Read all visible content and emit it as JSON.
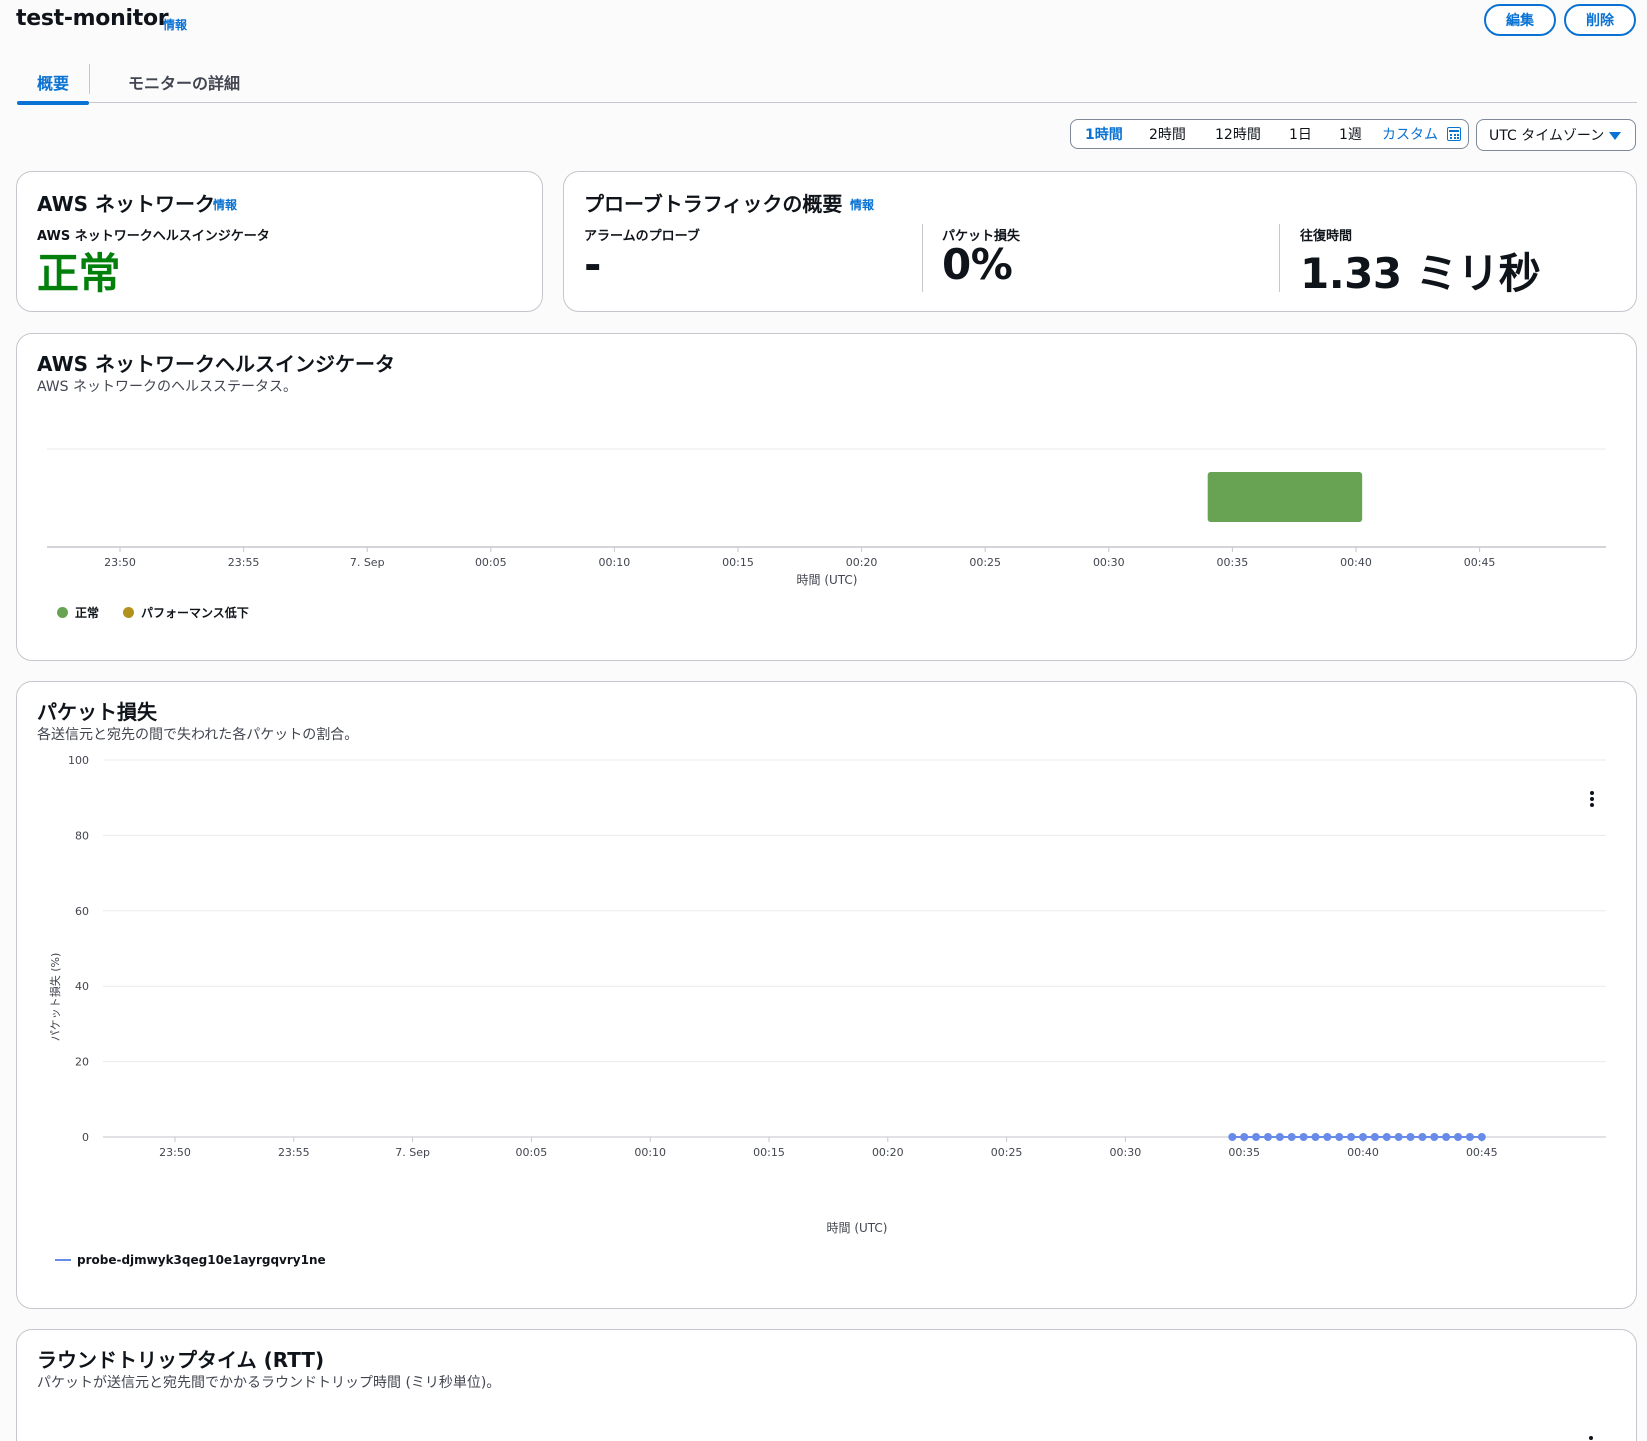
{
  "header": {
    "title": "test-monitor",
    "info_label": "情報",
    "edit_label": "編集",
    "delete_label": "削除"
  },
  "tabs": [
    {
      "label": "概要",
      "active": true
    },
    {
      "label": "モニターの詳細",
      "active": false
    }
  ],
  "time_range": {
    "options": [
      "1時間",
      "2時間",
      "12時間",
      "1日",
      "1週"
    ],
    "selected": "1時間",
    "custom_label": "カスタム",
    "timezone_label": "UTC タイムゾーン"
  },
  "aws_network_card": {
    "title": "AWS ネットワーク",
    "info_label": "情報",
    "indicator_label": "AWS ネットワークヘルスインジケータ",
    "indicator_value": "正常",
    "status_color": "#037f0c"
  },
  "probe_traffic_card": {
    "title": "プローブトラフィックの概要",
    "info_label": "情報",
    "metrics": [
      {
        "label": "アラームのプローブ",
        "value": "-"
      },
      {
        "label": "パケット損失",
        "value": "0%"
      },
      {
        "label": "往復時間",
        "value": "1.33 ミリ秒"
      }
    ]
  },
  "health_panel": {
    "title": "AWS ネットワークヘルスインジケータ",
    "subtitle": "AWS ネットワークのヘルスステータス。",
    "x_ticks": [
      "23:50",
      "23:55",
      "7. Sep",
      "00:05",
      "00:10",
      "00:15",
      "00:20",
      "00:25",
      "00:30",
      "00:35",
      "00:40",
      "00:45"
    ],
    "x_axis_label": "時間 (UTC)",
    "legend": [
      {
        "label": "正常",
        "color": "#67a353"
      },
      {
        "label": "パフォーマンス低下",
        "color": "#b2911c"
      }
    ]
  },
  "packet_loss_panel": {
    "title": "パケット損失",
    "subtitle": "各送信元と宛先の間で失われた各パケットの割合。",
    "y_axis_label": "パケット損失 (%)",
    "x_axis_label": "時間 (UTC)",
    "menu_icon": "more-vertical-icon",
    "legend_label": "probe-djmwyk3qeg10e1ayrgqvry1ne",
    "series_color": "#688ae8"
  },
  "rtt_panel": {
    "title": "ラウンドトリップタイム (RTT)",
    "subtitle": "パケットが送信元と宛先間でかかるラウンドトリップ時間 (ミリ秒単位)。"
  },
  "chart_data": [
    {
      "type": "bar",
      "title": "AWS ネットワークヘルスインジケータ",
      "xlabel": "時間 (UTC)",
      "x_ticks": [
        "23:50",
        "23:55",
        "7. Sep",
        "00:05",
        "00:10",
        "00:15",
        "00:20",
        "00:25",
        "00:30",
        "00:35",
        "00:40",
        "00:45"
      ],
      "series": [
        {
          "name": "正常",
          "color": "#67a353",
          "intervals": [
            {
              "start": "00:34",
              "end": "00:40:15",
              "status": "正常"
            }
          ]
        },
        {
          "name": "パフォーマンス低下",
          "color": "#b2911c",
          "intervals": []
        }
      ],
      "legend": "bottom-left",
      "grid": false
    },
    {
      "type": "line",
      "title": "パケット損失",
      "xlabel": "時間 (UTC)",
      "ylabel": "パケット損失 (%)",
      "ylim": [
        0,
        100
      ],
      "y_ticks": [
        0,
        20,
        40,
        60,
        80,
        100
      ],
      "x_ticks": [
        "23:50",
        "23:55",
        "7. Sep",
        "00:05",
        "00:10",
        "00:15",
        "00:20",
        "00:25",
        "00:30",
        "00:35",
        "00:40",
        "00:45"
      ],
      "series": [
        {
          "name": "probe-djmwyk3qeg10e1ayrgqvry1ne",
          "color": "#688ae8",
          "x": [
            "00:34:30",
            "00:35:00",
            "00:35:30",
            "00:36:00",
            "00:36:30",
            "00:37:00",
            "00:37:30",
            "00:38:00",
            "00:38:30",
            "00:39:00",
            "00:39:30",
            "00:40:00",
            "00:40:30",
            "00:41:00",
            "00:41:30",
            "00:42:00",
            "00:42:30",
            "00:43:00",
            "00:43:30",
            "00:44:00",
            "00:44:30",
            "00:45:00"
          ],
          "values": [
            0,
            0,
            0,
            0,
            0,
            0,
            0,
            0,
            0,
            0,
            0,
            0,
            0,
            0,
            0,
            0,
            0,
            0,
            0,
            0,
            0,
            0
          ]
        }
      ],
      "legend": "bottom-left",
      "grid": true
    }
  ]
}
